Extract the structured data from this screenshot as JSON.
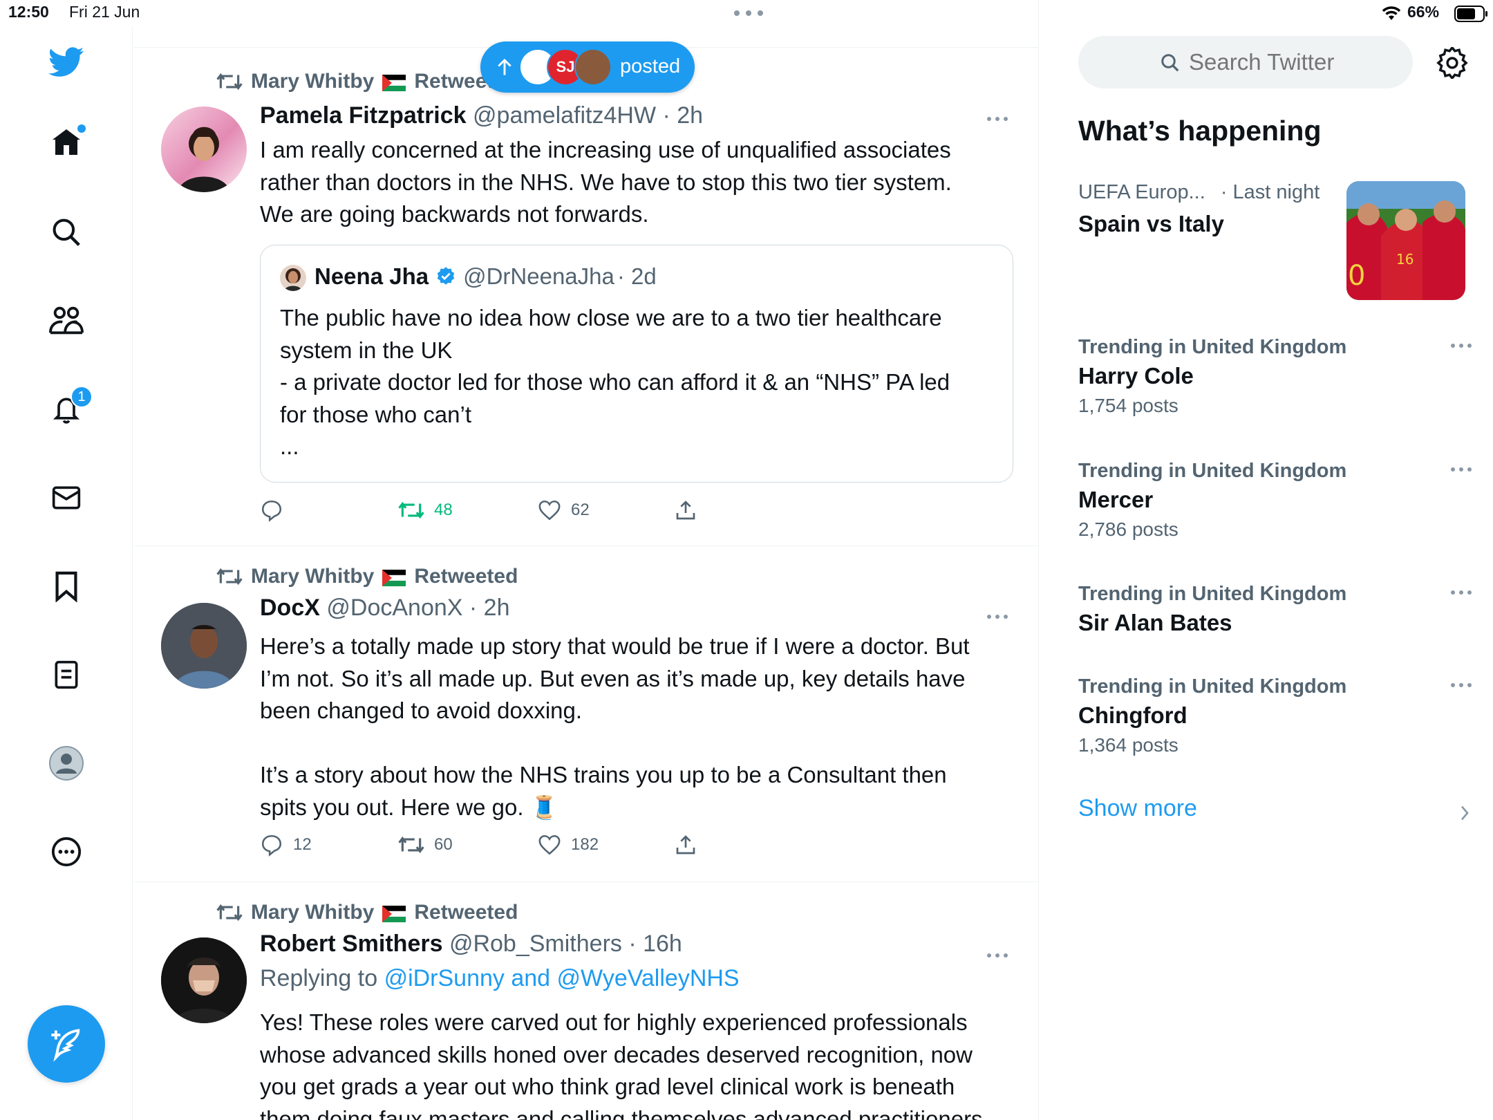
{
  "status": {
    "time": "12:50",
    "date": "Fri 21 Jun",
    "battery": "66%"
  },
  "new_posts_pill": {
    "label": "posted"
  },
  "nav": {
    "notifications_badge": "1"
  },
  "tweets": [
    {
      "retweeted_by": "Mary Whitby",
      "retweeted_label": "Retweeted",
      "author": "Pamela Fitzpatrick",
      "handle": "@pamelafitz4HW",
      "time": "· 2h",
      "text": [
        "I am really concerned at the increasing use of unqualified associates",
        "rather than doctors in the NHS. We have to stop this two tier system.",
        "We are going backwards not forwards."
      ],
      "quote": {
        "author": "Neena Jha",
        "handle": "@DrNeenaJha",
        "time": "· 2d",
        "text": [
          "The public have no idea how close we are to a two tier healthcare",
          "system in the UK",
          "- a private doctor led for those who can afford it & an “NHS” PA led",
          "for those who can’t",
          "..."
        ]
      },
      "replies": "",
      "retweets": "48",
      "likes": "62"
    },
    {
      "retweeted_by": "Mary Whitby",
      "retweeted_label": "Retweeted",
      "author": "DocX",
      "handle": "@DocAnonX",
      "time": "· 2h",
      "text": [
        "Here’s a totally made up story that would be true if I were a doctor. But",
        "I’m not. So it’s all made up. But even as it’s made up, key details have",
        "been changed to avoid doxxing.",
        "",
        "It’s a story about how the NHS trains you up to be a Consultant then",
        "spits you out. Here we go. 🧵"
      ],
      "replies": "12",
      "retweets": "60",
      "likes": "182"
    },
    {
      "retweeted_by": "Mary Whitby",
      "retweeted_label": "Retweeted",
      "author": "Robert Smithers",
      "handle": "@Rob_Smithers",
      "time": "· 16h",
      "replying_prefix": "Replying to",
      "replying_to": "@iDrSunny and @WyeValleyNHS",
      "text": [
        "Yes! These roles were carved out  for highly experienced professionals",
        "whose advanced skills honed over decades deserved recognition, now",
        "you get grads a year out who think grad level clinical work is beneath",
        "them doing faux masters and calling themselves advanced practitioners"
      ]
    }
  ],
  "sidebar": {
    "search_placeholder": "Search Twitter",
    "heading": "What’s happening",
    "featured": {
      "category": "UEFA Europ...",
      "time": "· Last night",
      "title": "Spain vs Italy"
    },
    "trends": [
      {
        "category": "Trending in United Kingdom",
        "name": "Harry Cole",
        "count": "1,754 posts"
      },
      {
        "category": "Trending in United Kingdom",
        "name": "Mercer",
        "count": "2,786 posts"
      },
      {
        "category": "Trending in United Kingdom",
        "name": "Sir Alan Bates",
        "count": ""
      },
      {
        "category": "Trending in United Kingdom",
        "name": "Chingford",
        "count": "1,364 posts"
      }
    ],
    "show_more": "Show more"
  },
  "colors": {
    "accent": "#1d9bf0",
    "retweet_green": "#00ba7c",
    "secondary_text": "#536471",
    "border": "#eff3f4"
  }
}
